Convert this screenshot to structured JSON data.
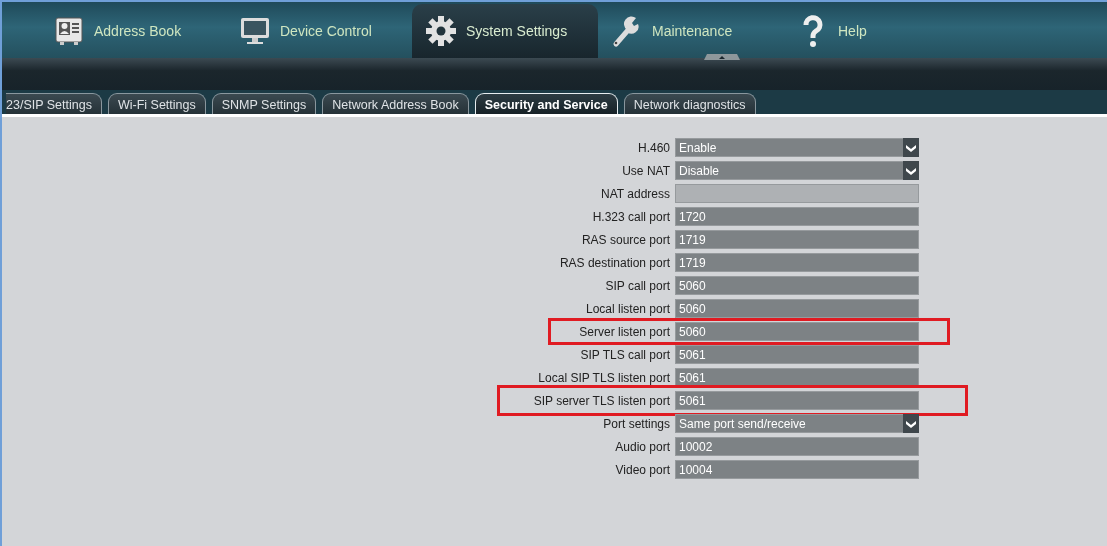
{
  "main_tabs": [
    {
      "label": "Address Book",
      "selected": false
    },
    {
      "label": "Device Control",
      "selected": false
    },
    {
      "label": "System Settings",
      "selected": true
    },
    {
      "label": "Maintenance",
      "selected": false
    },
    {
      "label": "Help",
      "selected": false
    }
  ],
  "sub_tabs": [
    {
      "label": "23/SIP Settings",
      "selected": false
    },
    {
      "label": "Wi-Fi Settings",
      "selected": false
    },
    {
      "label": "SNMP Settings",
      "selected": false
    },
    {
      "label": "Network Address Book",
      "selected": false
    },
    {
      "label": "Security and Service",
      "selected": true
    },
    {
      "label": "Network diagnostics",
      "selected": false
    }
  ],
  "fields": [
    {
      "label": "H.460",
      "kind": "select",
      "value": "Enable",
      "disabled": false,
      "highlighted": false
    },
    {
      "label": "Use NAT",
      "kind": "select",
      "value": "Disable",
      "disabled": false,
      "highlighted": false
    },
    {
      "label": "NAT address",
      "kind": "text",
      "disabled": true,
      "highlighted": false
    },
    {
      "label": "H.323 call port",
      "kind": "text",
      "value": "1720",
      "disabled": false,
      "highlighted": false
    },
    {
      "label": "RAS source port",
      "kind": "text",
      "value": "1719",
      "disabled": false,
      "highlighted": false
    },
    {
      "label": "RAS destination port",
      "kind": "text",
      "value": "1719",
      "disabled": false,
      "highlighted": false
    },
    {
      "label": "SIP call port",
      "kind": "text",
      "value": "5060",
      "disabled": false,
      "highlighted": false
    },
    {
      "label": "Local listen port",
      "kind": "text",
      "value": "5060",
      "disabled": false,
      "highlighted": false
    },
    {
      "label": "Server listen port",
      "kind": "text",
      "value": "5060",
      "disabled": false,
      "highlighted": true
    },
    {
      "label": "SIP TLS call port",
      "kind": "text",
      "value": "5061",
      "disabled": false,
      "highlighted": false
    },
    {
      "label": "Local SIP TLS listen port",
      "kind": "text",
      "value": "5061",
      "disabled": false,
      "highlighted": false
    },
    {
      "label": "SIP server TLS listen port",
      "kind": "text",
      "value": "5061",
      "disabled": false,
      "highlighted": true
    },
    {
      "label": "Port settings",
      "kind": "select",
      "value": "Same port send/receive",
      "disabled": false,
      "highlighted": false
    },
    {
      "label": "Audio port",
      "kind": "text",
      "value": "10002",
      "disabled": false,
      "highlighted": false
    },
    {
      "label": "Video port",
      "kind": "text",
      "value": "10004",
      "disabled": false,
      "highlighted": false
    }
  ]
}
